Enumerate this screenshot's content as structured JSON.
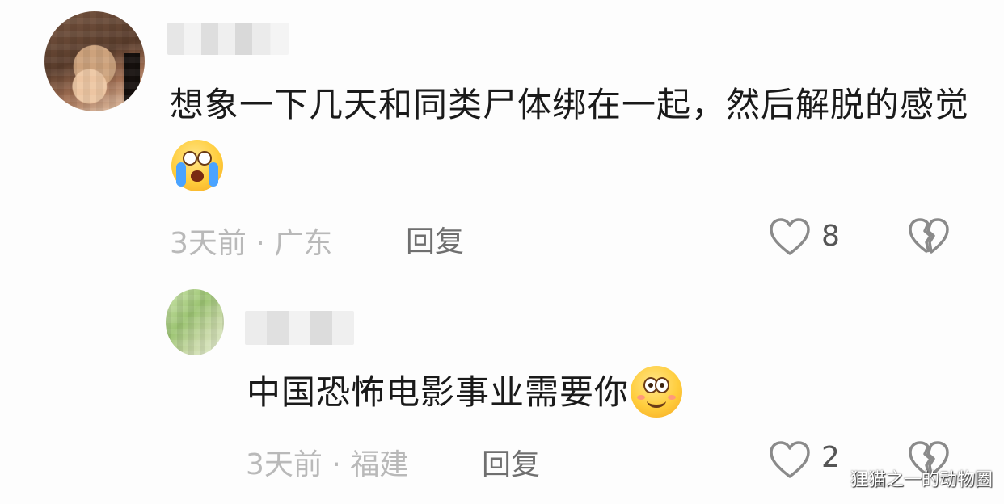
{
  "comments": [
    {
      "text": "想象一下几天和同类尸体绑在一起，然后解脱的感觉",
      "emoji": "loudly-crying-emoji",
      "time": "3天前",
      "separator": " · ",
      "location": "广东",
      "reply_label": "回复",
      "like_count": "8"
    },
    {
      "text": "中国恐怖电影事业需要你",
      "emoji": "smiling-emoji",
      "time": "3天前",
      "separator": " · ",
      "location": "福建",
      "reply_label": "回复",
      "like_count": "2"
    }
  ],
  "watermark": "狸猫之一的动物圈",
  "icons": {
    "like": "heart-outline-icon",
    "dislike": "broken-heart-icon"
  },
  "colors": {
    "meta_text": "#b9b9b9",
    "reply_text": "#6f6f6f",
    "icon_stroke": "#8a8a8a"
  }
}
